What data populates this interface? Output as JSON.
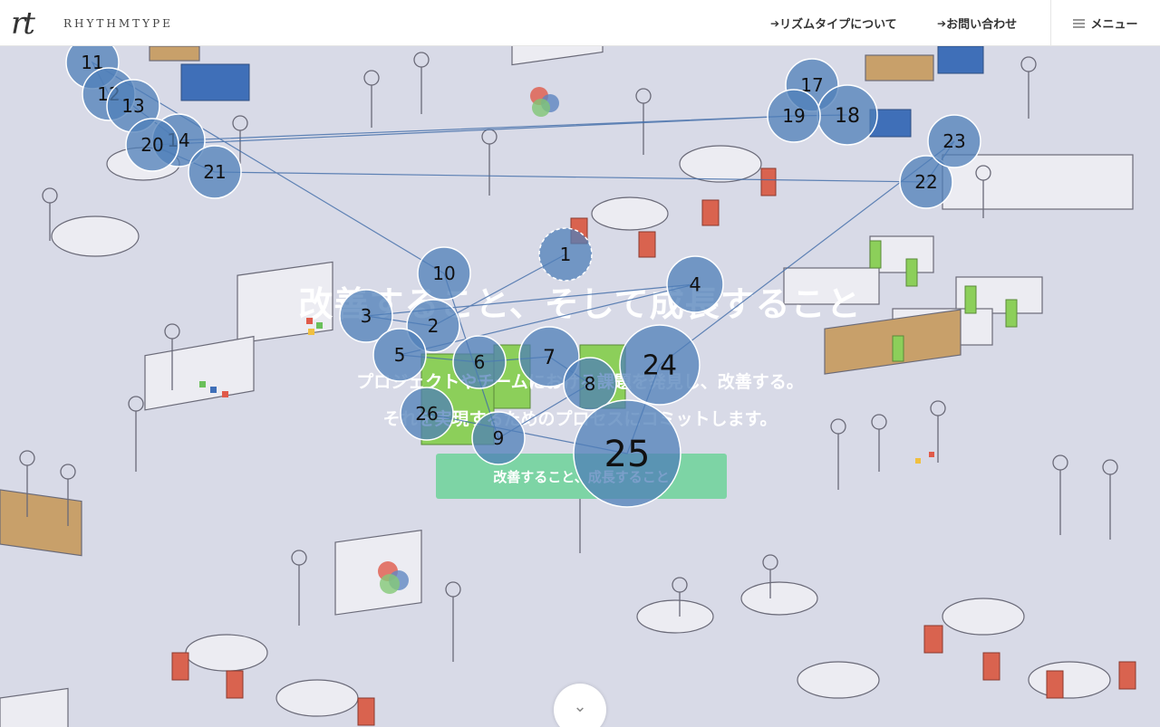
{
  "header": {
    "logo_mark": "rt",
    "logo_text": "RHYTHMTYPE",
    "nav": [
      {
        "label": "リズムタイプについて"
      },
      {
        "label": "お問い合わせ"
      }
    ],
    "menu_label": "メニュー"
  },
  "hero": {
    "title": "改善すること、そして成長すること",
    "line1": "プロジェクトやチームにおける課題を発見し、改善する。",
    "line2": "それを実現するためのプロセスにコミットします。",
    "cta": "改善すること、成長すること"
  },
  "markers": [
    "1",
    "2",
    "3",
    "4",
    "5",
    "6",
    "7",
    "8",
    "9",
    "10",
    "11",
    "12",
    "13",
    "14",
    "17",
    "18",
    "19",
    "20",
    "21",
    "22",
    "23",
    "24",
    "25",
    "26"
  ],
  "colors": {
    "accent_green": "#7dd4a5",
    "marker_fill": "#4f7fb8",
    "background": "#d8dae7"
  }
}
